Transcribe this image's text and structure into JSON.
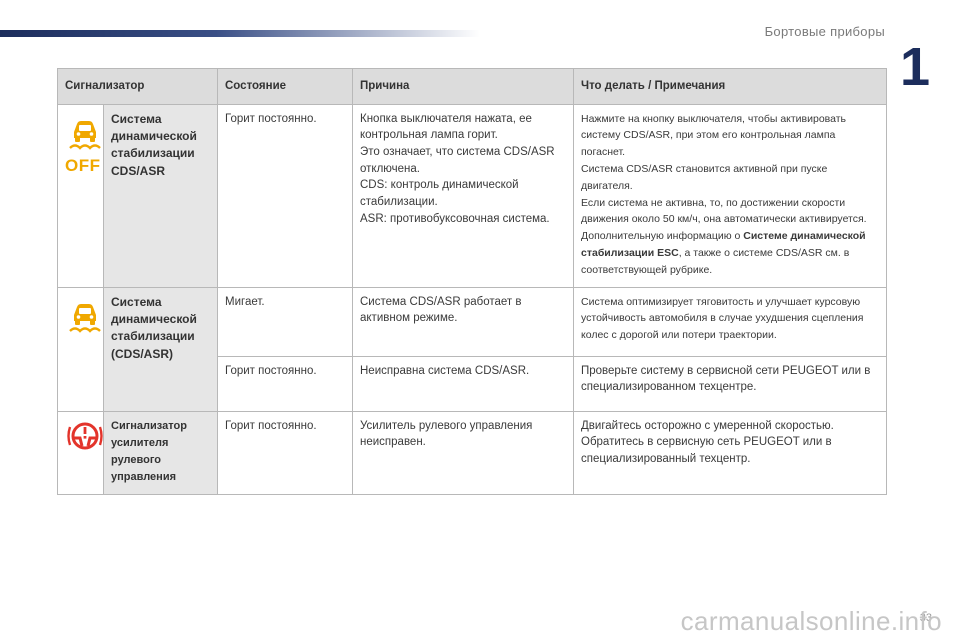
{
  "header": {
    "section_title": "Бортовые приборы",
    "chapter_number": "1"
  },
  "footer": {
    "page_number": "33",
    "watermark": "carmanualsonline.info"
  },
  "table": {
    "columns": {
      "indicator": "Сигнализатор",
      "state": "Состояние",
      "cause": "Причина",
      "action": "Что делать / Примечания"
    },
    "rows": {
      "cds_off": {
        "icon_text": "OFF",
        "name": "Система динамической стабилизации CDS/ASR",
        "state": "Горит постоянно.",
        "cause": "Кнопка выключателя нажата, ее контрольная лампа горит.\nЭто означает, что система CDS/ASR отключена.\nCDS: контроль динамической стабилизации.\nASR: противобуксовочная система.",
        "action_part1": "Нажмите на кнопку выключателя, чтобы активировать систему CDS/ASR, при этом его контрольная лампа погаснет.\nСистема CDS/ASR становится активной при пуске двигателя.\nЕсли система не активна, то, по достижении скорости движения около 50 км/ч, она автоматически активируется.\nДополнительную информацию о ",
        "action_bold": "Системе динамической стабилизации ESC",
        "action_part2": ", а также о системе CDS/ASR см. в соответствующей рубрике."
      },
      "cds_active": {
        "name": "Система динамической стабилизации (CDS/ASR)",
        "state": "Мигает.",
        "cause": "Система CDS/ASR работает в активном режиме.",
        "action": "Система оптимизирует тяговитость и улучшает курсовую устойчивость автомобиля в случае ухудшения сцепления колес с дорогой или потери траектории."
      },
      "cds_fault": {
        "state": "Горит постоянно.",
        "cause": "Неисправна система CDS/ASR.",
        "action": "Проверьте систему в сервисной сети PEUGEOT или в специализированном техцентре."
      },
      "power_steering": {
        "name": "Сигнализатор усилителя рулевого управления",
        "state": "Горит постоянно.",
        "cause": "Усилитель рулевого управления неисправен.",
        "action": "Двигайтесь осторожно с умеренной скоростью.\nОбратитесь в сервисную сеть PEUGEOT или в специализированный техцентр."
      }
    }
  },
  "colors": {
    "amber": "#f0a800",
    "steering_red": "#e3342b",
    "header_bg": "#dcdcdc",
    "name_bg": "#e6e6e6",
    "brand_blue": "#1c2d5c"
  },
  "icons": [
    "esc-off-icon",
    "esc-active-icon",
    "power-steering-warning-icon"
  ]
}
